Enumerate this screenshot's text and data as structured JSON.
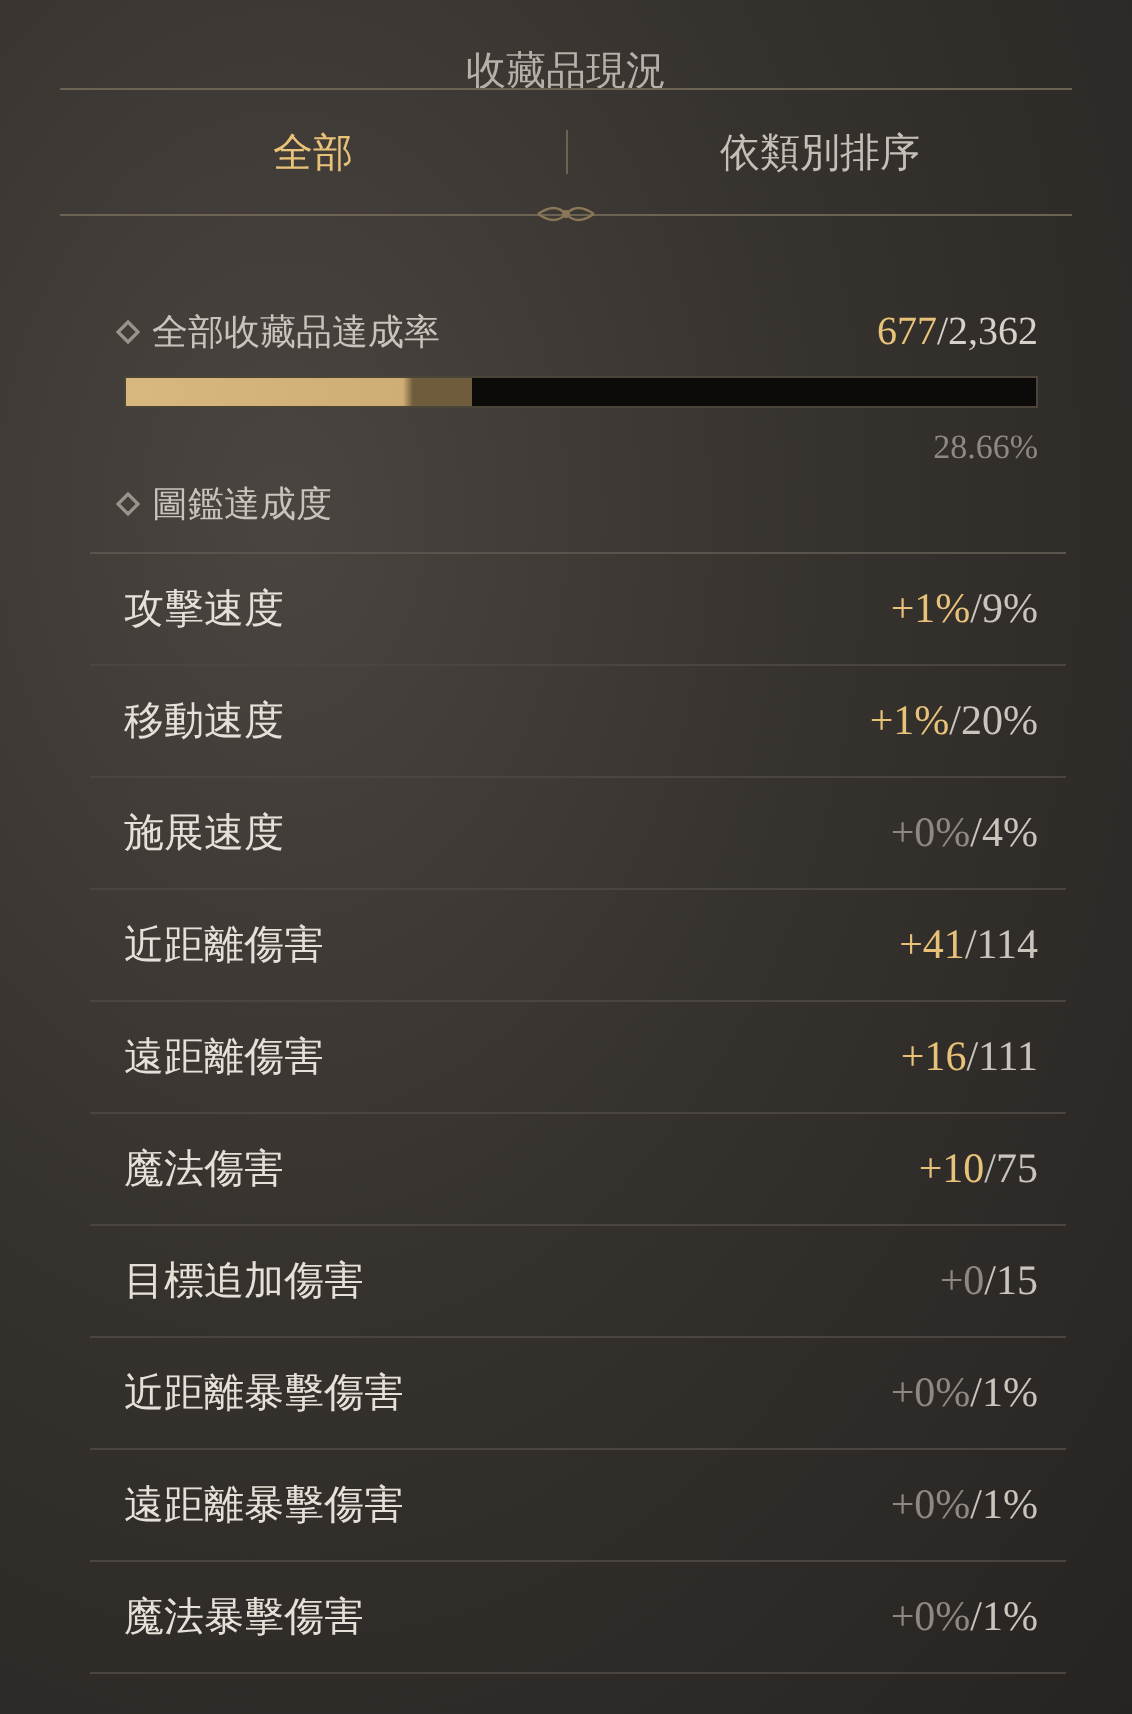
{
  "title": "收藏品現況",
  "tabs": [
    {
      "label": "全部",
      "selected": true
    },
    {
      "label": "依類別排序",
      "selected": false
    }
  ],
  "overall": {
    "label": "全部收藏品達成率",
    "collected": "677",
    "total": "/2,362",
    "level": 0.38,
    "percent": "28.66%"
  },
  "section": {
    "label": "圖鑑達成度"
  },
  "stats": [
    {
      "label": "攻擊速度",
      "gain": "+1%",
      "cap": "/9%",
      "achieved": true
    },
    {
      "label": "移動速度",
      "gain": "+1%",
      "cap": "/20%",
      "achieved": true
    },
    {
      "label": "施展速度",
      "gain": "+0%",
      "cap": "/4%",
      "achieved": false
    },
    {
      "label": "近距離傷害",
      "gain": "+41",
      "cap": "/114",
      "achieved": true
    },
    {
      "label": "遠距離傷害",
      "gain": "+16",
      "cap": "/111",
      "achieved": true
    },
    {
      "label": "魔法傷害",
      "gain": "+10",
      "cap": "/75",
      "achieved": true
    },
    {
      "label": "目標追加傷害",
      "gain": "+0",
      "cap": "/15",
      "achieved": false
    },
    {
      "label": "近距離暴擊傷害",
      "gain": "+0%",
      "cap": "/1%",
      "achieved": false
    },
    {
      "label": "遠距離暴擊傷害",
      "gain": "+0%",
      "cap": "/1%",
      "achieved": false
    },
    {
      "label": "魔法暴擊傷害",
      "gain": "+0%",
      "cap": "/1%",
      "achieved": false
    }
  ]
}
